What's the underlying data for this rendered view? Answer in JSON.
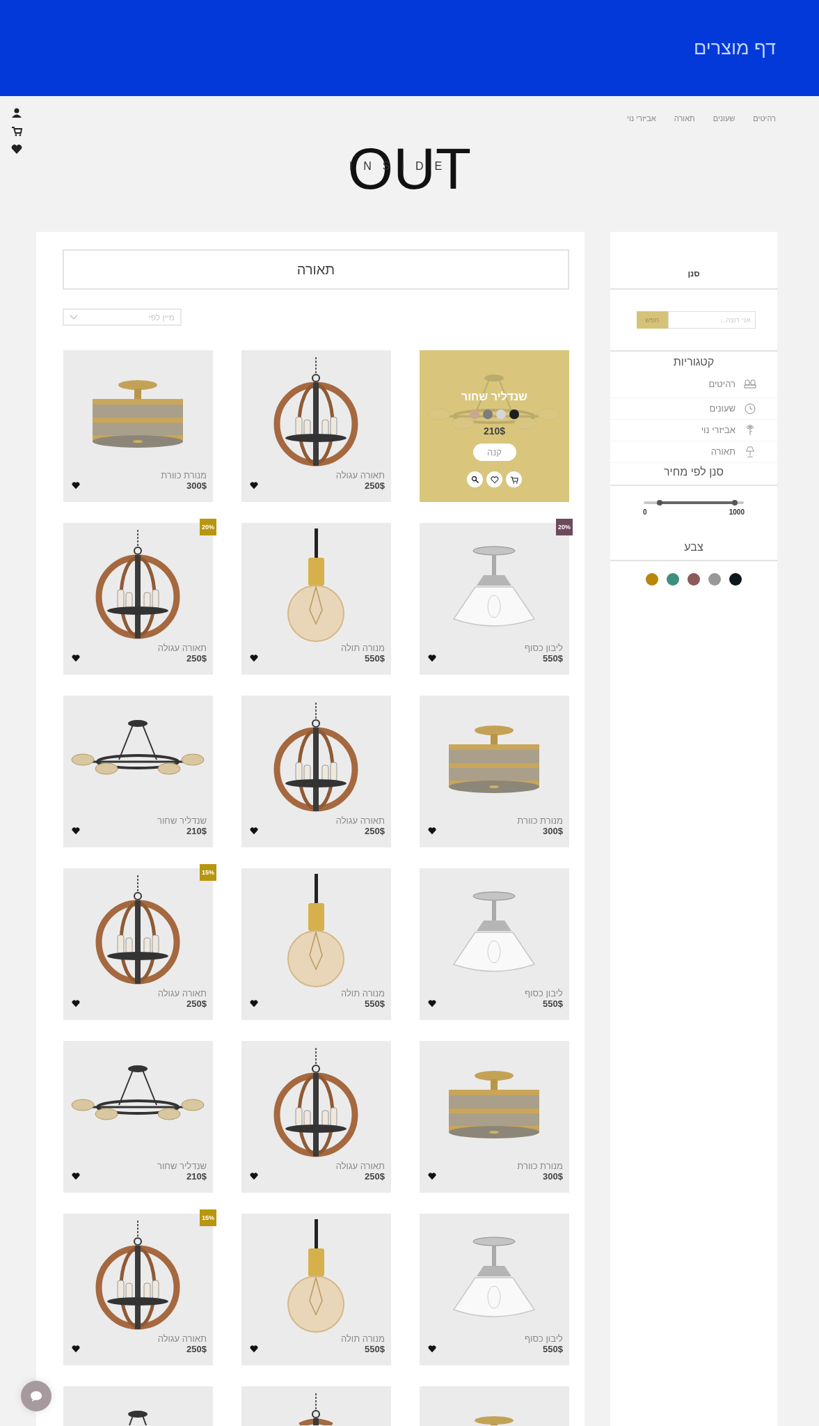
{
  "header": {
    "title": "דף מוצרים"
  },
  "nav": [
    {
      "label": "רהיטים"
    },
    {
      "label": "שעונים"
    },
    {
      "label": "תאורה"
    },
    {
      "label": "אביזרי נוי"
    }
  ],
  "logo": {
    "word": "OUT",
    "subword": "INSIDE"
  },
  "sidebar": {
    "filter_title": "סנן",
    "search": {
      "placeholder": "אני רוצה...",
      "button": "חפש"
    },
    "categories_title": "קטגוריות",
    "categories": [
      {
        "label": "רהיטים",
        "kind": "sofa"
      },
      {
        "label": "שעונים",
        "kind": "clock"
      },
      {
        "label": "אביזרי נוי",
        "kind": "flower"
      },
      {
        "label": "תאורה",
        "kind": "lamp"
      }
    ],
    "price_title": "סנן לפי מחיר",
    "price_slider": {
      "handles": [
        {
          "level": 0.16
        },
        {
          "level": 0.91
        }
      ],
      "min_label": "0",
      "max_label": "1000"
    },
    "color_title": "צבע",
    "colors": [
      {
        "color": "#b8860b"
      },
      {
        "color": "#3f8f7e"
      },
      {
        "color": "#8d5a5b"
      },
      {
        "color": "#999999"
      },
      {
        "color": "#0b1a1a"
      }
    ]
  },
  "content": {
    "title": "תאורה",
    "sort": {
      "placeholder": "מיין לפי"
    },
    "products": [
      {
        "kind": "chandelier",
        "name": "שנדליר שחור",
        "price": "210$",
        "hovered": true,
        "swatches": [
          {
            "color": "#c9a88f"
          },
          {
            "color": "#7d7d7d"
          },
          {
            "color": "#d6d6d6"
          },
          {
            "color": "#1e1e1e"
          }
        ],
        "buy_label": "קנה"
      },
      {
        "kind": "orb",
        "name": "תאורה עגולה",
        "price": "250$",
        "hovered": false
      },
      {
        "kind": "drum",
        "name": "מנורת כוורת",
        "price": "300$",
        "hovered": false
      },
      {
        "kind": "schoolhouse",
        "name": "ליבון כסוף",
        "price": "550$",
        "hovered": false,
        "badge": {
          "label": "20%",
          "color": "#6c4a5e"
        }
      },
      {
        "kind": "bulb",
        "name": "מנורה תולה",
        "price": "550$",
        "hovered": false
      },
      {
        "kind": "orb",
        "name": "תאורה עגולה",
        "price": "250$",
        "hovered": false,
        "badge": {
          "label": "20%",
          "color": "#b8960f"
        }
      },
      {
        "kind": "drum",
        "name": "מנורת כוורת",
        "price": "300$",
        "hovered": false
      },
      {
        "kind": "orb",
        "name": "תאורה עגולה",
        "price": "250$",
        "hovered": false
      },
      {
        "kind": "chandelier",
        "name": "שנדליר שחור",
        "price": "210$",
        "hovered": false
      },
      {
        "kind": "schoolhouse",
        "name": "ליבון כסוף",
        "price": "550$",
        "hovered": false
      },
      {
        "kind": "bulb",
        "name": "מנורה תולה",
        "price": "550$",
        "hovered": false
      },
      {
        "kind": "orb",
        "name": "תאורה עגולה",
        "price": "250$",
        "hovered": false,
        "badge": {
          "label": "15%",
          "color": "#b8960f"
        }
      },
      {
        "kind": "drum",
        "name": "מנורת כוורת",
        "price": "300$",
        "hovered": false
      },
      {
        "kind": "orb",
        "name": "תאורה עגולה",
        "price": "250$",
        "hovered": false
      },
      {
        "kind": "chandelier",
        "name": "שנדליר שחור",
        "price": "210$",
        "hovered": false
      },
      {
        "kind": "schoolhouse",
        "name": "ליבון כסוף",
        "price": "550$",
        "hovered": false
      },
      {
        "kind": "bulb",
        "name": "מנורה תולה",
        "price": "550$",
        "hovered": false
      },
      {
        "kind": "orb",
        "name": "תאורה עגולה",
        "price": "250$",
        "hovered": false,
        "badge": {
          "label": "15%",
          "color": "#b8960f"
        }
      },
      {
        "kind": "drum",
        "hovered": false
      },
      {
        "kind": "orb",
        "hovered": false
      },
      {
        "kind": "chandelier",
        "hovered": false
      }
    ]
  }
}
